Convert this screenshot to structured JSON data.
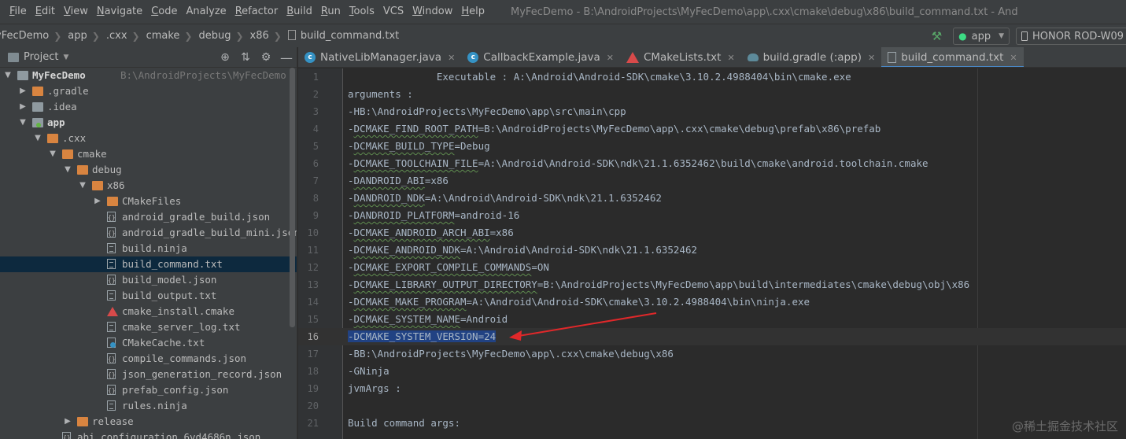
{
  "menu": {
    "items": [
      {
        "m": "F",
        "rest": "ile"
      },
      {
        "m": "E",
        "rest": "dit"
      },
      {
        "m": "V",
        "rest": "iew"
      },
      {
        "m": "N",
        "rest": "avigate"
      },
      {
        "m": "C",
        "rest": "ode"
      },
      {
        "m": "",
        "rest": "Analyze"
      },
      {
        "m": "R",
        "rest": "efactor"
      },
      {
        "m": "B",
        "rest": "uild"
      },
      {
        "m": "R",
        "rest": "un",
        "m_after": true
      },
      {
        "m": "T",
        "rest": "ools"
      },
      {
        "m": "",
        "rest": "VCS"
      },
      {
        "m": "W",
        "rest": "indow"
      },
      {
        "m": "H",
        "rest": "elp"
      }
    ],
    "window_title": "MyFecDemo - B:\\AndroidProjects\\MyFecDemo\\app\\.cxx\\cmake\\debug\\x86\\build_command.txt - And"
  },
  "breadcrumbs": [
    "yFecDemo",
    "app",
    ".cxx",
    "cmake",
    "debug",
    "x86",
    "build_command.txt"
  ],
  "toolbar": {
    "run_config": "app",
    "device": "HONOR ROD-W09"
  },
  "project_panel": {
    "title": "Project",
    "tree": [
      {
        "depth": 0,
        "arrow": "▼",
        "icon": "folder-grey",
        "label": "MyFecDemo",
        "bold": true,
        "path": "B:\\AndroidProjects\\MyFecDemo"
      },
      {
        "depth": 1,
        "arrow": "▶",
        "icon": "folder",
        "label": ".gradle"
      },
      {
        "depth": 1,
        "arrow": "▶",
        "icon": "folder-grey",
        "label": ".idea"
      },
      {
        "depth": 1,
        "arrow": "▼",
        "icon": "folder-module",
        "label": "app",
        "bold": true
      },
      {
        "depth": 2,
        "arrow": "▼",
        "icon": "folder",
        "label": ".cxx"
      },
      {
        "depth": 3,
        "arrow": "▼",
        "icon": "folder",
        "label": "cmake"
      },
      {
        "depth": 4,
        "arrow": "▼",
        "icon": "folder",
        "label": "debug"
      },
      {
        "depth": 5,
        "arrow": "▼",
        "icon": "folder",
        "label": "x86"
      },
      {
        "depth": 6,
        "arrow": "▶",
        "icon": "folder",
        "label": "CMakeFiles"
      },
      {
        "depth": 6,
        "arrow": "",
        "icon": "json",
        "label": "android_gradle_build.json"
      },
      {
        "depth": 6,
        "arrow": "",
        "icon": "json",
        "label": "android_gradle_build_mini.json"
      },
      {
        "depth": 6,
        "arrow": "",
        "icon": "txt",
        "label": "build.ninja"
      },
      {
        "depth": 6,
        "arrow": "",
        "icon": "txt",
        "label": "build_command.txt",
        "selected": true
      },
      {
        "depth": 6,
        "arrow": "",
        "icon": "json",
        "label": "build_model.json"
      },
      {
        "depth": 6,
        "arrow": "",
        "icon": "txt",
        "label": "build_output.txt"
      },
      {
        "depth": 6,
        "arrow": "",
        "icon": "cmake",
        "label": "cmake_install.cmake"
      },
      {
        "depth": 6,
        "arrow": "",
        "icon": "txt",
        "label": "cmake_server_log.txt"
      },
      {
        "depth": 6,
        "arrow": "",
        "icon": "cache",
        "label": "CMakeCache.txt"
      },
      {
        "depth": 6,
        "arrow": "",
        "icon": "json",
        "label": "compile_commands.json"
      },
      {
        "depth": 6,
        "arrow": "",
        "icon": "json",
        "label": "json_generation_record.json"
      },
      {
        "depth": 6,
        "arrow": "",
        "icon": "json",
        "label": "prefab_config.json"
      },
      {
        "depth": 6,
        "arrow": "",
        "icon": "txt",
        "label": "rules.ninja"
      },
      {
        "depth": 4,
        "arrow": "▶",
        "icon": "folder",
        "label": "release"
      },
      {
        "depth": 3,
        "arrow": "",
        "icon": "json",
        "label": "abi_configuration_6vd4686n.json"
      }
    ]
  },
  "tabs": [
    {
      "icon": "java",
      "label": "NativeLibManager.java",
      "active": false
    },
    {
      "icon": "java",
      "label": "CallbackExample.java",
      "active": false
    },
    {
      "icon": "cmake",
      "label": "CMakeLists.txt",
      "active": false
    },
    {
      "icon": "gradle",
      "label": "build.gradle (:app)",
      "active": false
    },
    {
      "icon": "txt",
      "label": "build_command.txt",
      "active": true
    }
  ],
  "editor": {
    "lines": [
      "               Executable : A:\\Android\\Android-SDK\\cmake\\3.10.2.4988404\\bin\\cmake.exe",
      "arguments : ",
      "-HB:\\AndroidProjects\\MyFecDemo\\app\\src\\main\\cpp",
      "-DCMAKE_FIND_ROOT_PATH=B:\\AndroidProjects\\MyFecDemo\\app\\.cxx\\cmake\\debug\\prefab\\x86\\prefab",
      "-DCMAKE_BUILD_TYPE=Debug",
      "-DCMAKE_TOOLCHAIN_FILE=A:\\Android\\Android-SDK\\ndk\\21.1.6352462\\build\\cmake\\android.toolchain.cmake",
      "-DANDROID_ABI=x86",
      "-DANDROID_NDK=A:\\Android\\Android-SDK\\ndk\\21.1.6352462",
      "-DANDROID_PLATFORM=android-16",
      "-DCMAKE_ANDROID_ARCH_ABI=x86",
      "-DCMAKE_ANDROID_NDK=A:\\Android\\Android-SDK\\ndk\\21.1.6352462",
      "-DCMAKE_EXPORT_COMPILE_COMMANDS=ON",
      "-DCMAKE_LIBRARY_OUTPUT_DIRECTORY=B:\\AndroidProjects\\MyFecDemo\\app\\build\\intermediates\\cmake\\debug\\obj\\x86",
      "-DCMAKE_MAKE_PROGRAM=A:\\Android\\Android-SDK\\cmake\\3.10.2.4988404\\bin\\ninja.exe",
      "-DCMAKE_SYSTEM_NAME=Android",
      "-DCMAKE_SYSTEM_VERSION=24",
      "-BB:\\AndroidProjects\\MyFecDemo\\app\\.cxx\\cmake\\debug\\x86",
      "-GNinja",
      "jvmArgs : ",
      "",
      "Build command args:"
    ],
    "current_line": 16,
    "highlighted_line": 16
  },
  "watermark": "@稀土掘金技术社区",
  "colors": {
    "selection": "#214283",
    "annotation_arrow": "#e0282a",
    "tab_accent": "#4a88c7"
  }
}
